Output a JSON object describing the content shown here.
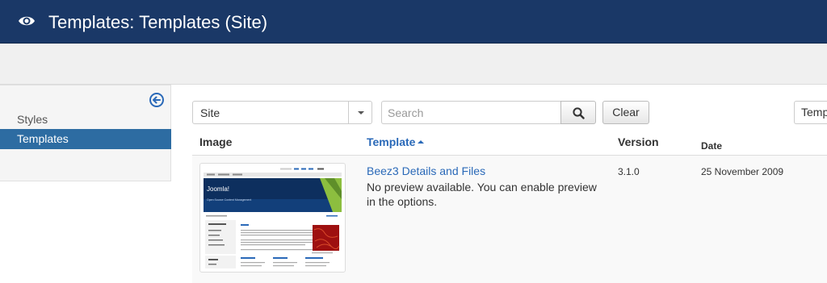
{
  "header": {
    "icon": "eye-icon",
    "title": "Templates: Templates (Site)",
    "background": "#1a3867"
  },
  "sidebar": {
    "toggle_icon": "arrow-circle-left-icon",
    "items": [
      {
        "label": "Styles",
        "active": false
      },
      {
        "label": "Templates",
        "active": true
      }
    ],
    "active_color": "#2d6ca2"
  },
  "filters": {
    "client": {
      "selected": "Site"
    },
    "search": {
      "placeholder": "Search",
      "value": ""
    },
    "search_button_icon": "search-icon",
    "clear_label": "Clear",
    "sort": {
      "selected": "Temp"
    }
  },
  "table": {
    "columns": [
      "Image",
      "Template",
      "Version",
      "Date"
    ],
    "sort_column": "Template",
    "sort_dir": "asc",
    "rows": [
      {
        "name": "Beez3 Details and Files",
        "description": "No preview available. You can enable preview in the options.",
        "version": "3.1.0",
        "date": "25 November 2009",
        "thumbnail": {
          "brand": "Joomla!",
          "tagline": "Open Source Content Management"
        }
      }
    ]
  },
  "link_color": "#2a69b8"
}
